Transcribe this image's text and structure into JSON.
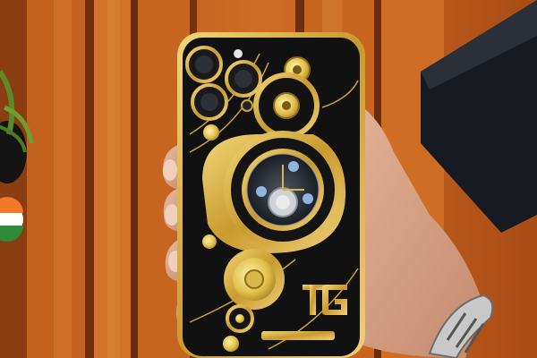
{
  "photo": {
    "subject": "luxury-phone-case",
    "brand_mark": "TG",
    "colors": {
      "wood_light": "#c6651f",
      "wood_dark": "#7a3a10",
      "gold": "#d9b84a",
      "gold_dark": "#8f6a15",
      "case_black": "#121212",
      "skin": "#d8a78c",
      "box": "#1b1f26"
    }
  }
}
